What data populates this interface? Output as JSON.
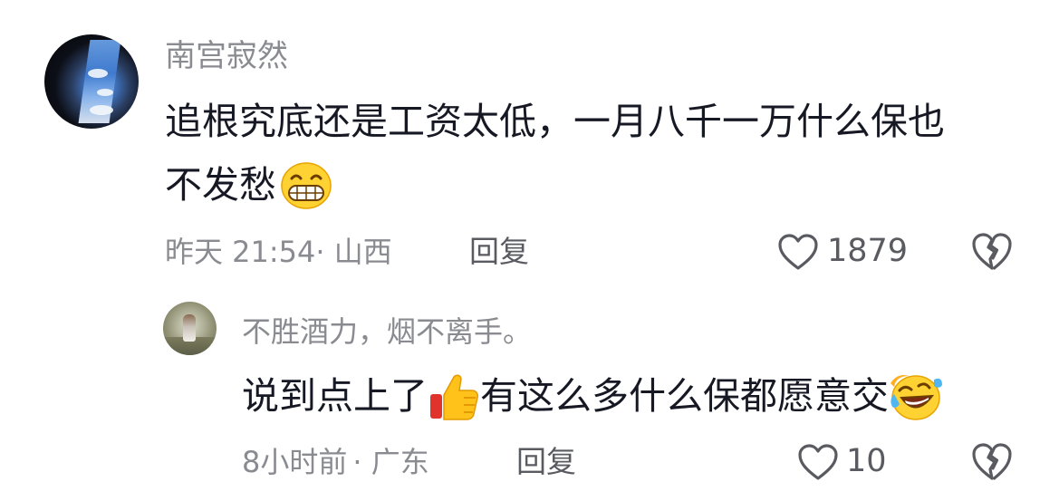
{
  "comment": {
    "username": "南宫寂然",
    "text_line1": "追根究底还是工资太低，一月八千一万什么保也",
    "text_line2": "不发愁",
    "emoji": "grinning-face-emoji",
    "time": "昨天 21:54",
    "location": "· 山西",
    "reply_label": "回复",
    "like_count": "1879",
    "like_icon": "heart-icon",
    "dislike_icon": "broken-heart-icon"
  },
  "reply": {
    "username": "不胜酒力，烟不离手。",
    "text_part1": "说到点上了",
    "emoji1": "thumbs-up-emoji",
    "text_part2": "有这么多什么保都愿意交",
    "emoji2": "rolling-laughing-emoji",
    "time": "8小时前",
    "location": "· 广东",
    "reply_label": "回复",
    "like_count": "10",
    "like_icon": "heart-icon",
    "dislike_icon": "broken-heart-icon"
  },
  "colors": {
    "text": "#161823",
    "meta": "#8a8b91",
    "action": "#5a5b61",
    "background": "#ffffff"
  }
}
